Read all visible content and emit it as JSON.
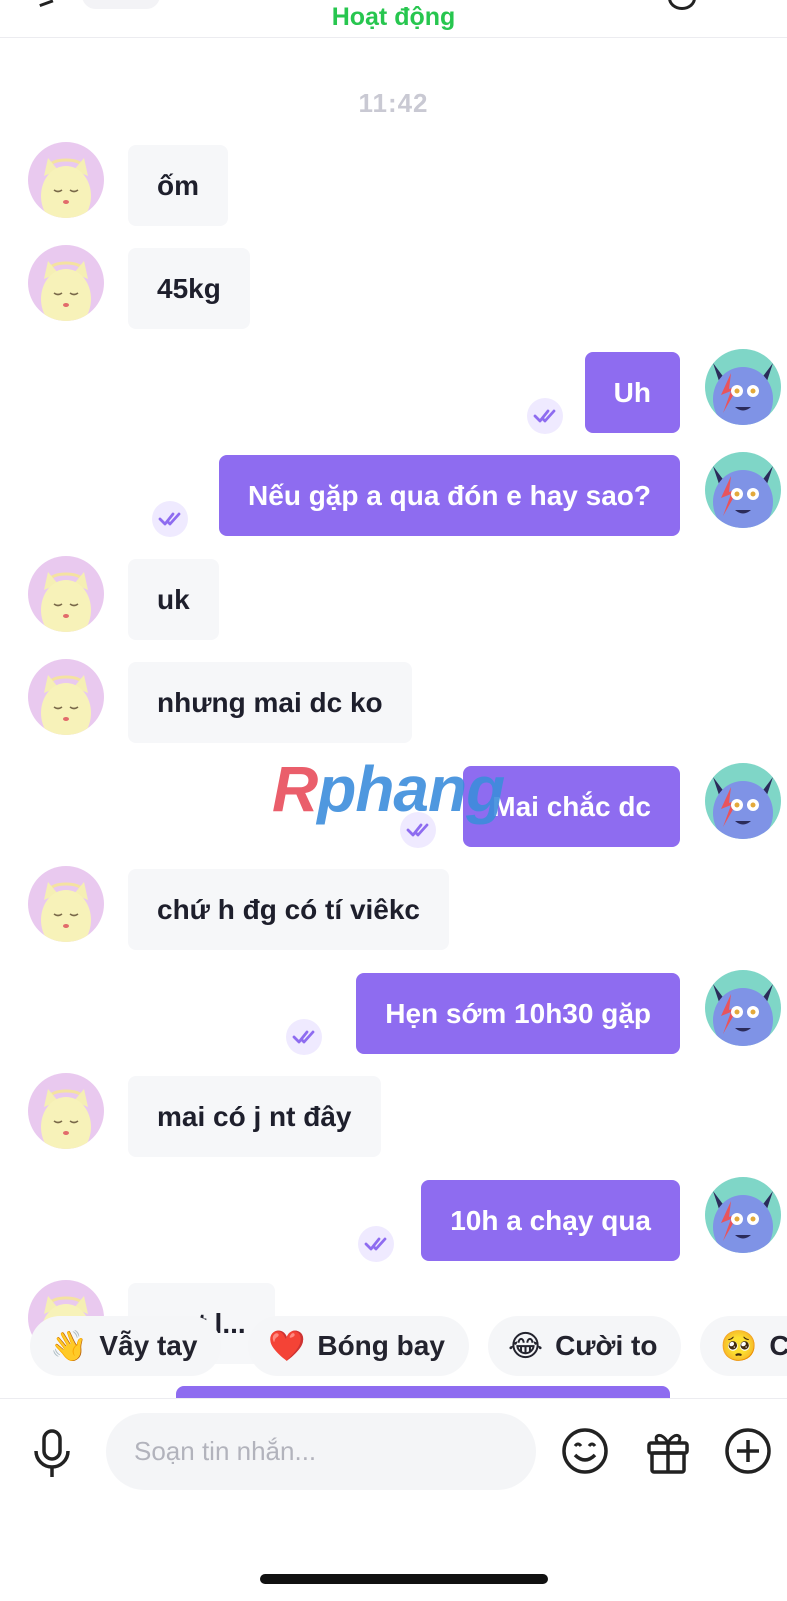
{
  "header": {
    "status": "Hoạt động"
  },
  "chat": {
    "timestamp": "11:42",
    "messages": [
      {
        "from": "them",
        "text": "ốm"
      },
      {
        "from": "them",
        "text": "45kg"
      },
      {
        "from": "me",
        "text": "Uh"
      },
      {
        "from": "me",
        "text": "Nếu gặp a qua đón e hay sao?"
      },
      {
        "from": "them",
        "text": "uk"
      },
      {
        "from": "them",
        "text": "nhưng mai dc ko"
      },
      {
        "from": "me",
        "text": "Mai chắc dc"
      },
      {
        "from": "them",
        "text": "chứ h đg có tí viêkc"
      },
      {
        "from": "me",
        "text": "Hẹn sớm 10h30 gặp"
      },
      {
        "from": "them",
        "text": "mai có j nt đây"
      },
      {
        "from": "me",
        "text": "10h a chạy qua"
      },
      {
        "from": "them",
        "text": "...nt l..."
      }
    ]
  },
  "watermark": {
    "text": "Rphang"
  },
  "reactions": [
    {
      "emoji": "👋",
      "label": "Vẫy tay"
    },
    {
      "emoji": "❤️",
      "label": "Bóng bay"
    },
    {
      "emoji": "😂",
      "label": "Cười to"
    },
    {
      "emoji": "🥺",
      "label": "C"
    }
  ],
  "composer": {
    "placeholder": "Soạn tin nhắn..."
  },
  "icons": {
    "microphone": "microphone-icon",
    "emoji": "smiley-icon",
    "gift": "gift-icon",
    "add": "plus-circle-icon",
    "read": "double-check-icon"
  },
  "colors": {
    "accent": "#8e6cf0",
    "status": "#27c64f",
    "incoming_bubble": "#f6f7f9",
    "timestamp": "#c9c9d3"
  }
}
